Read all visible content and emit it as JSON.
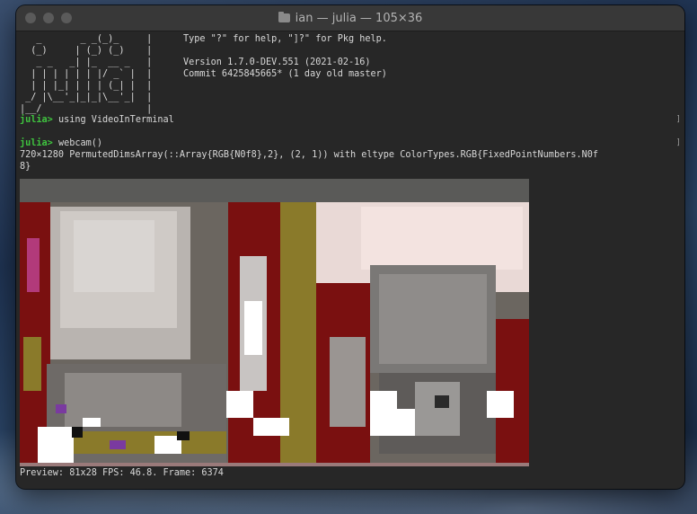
{
  "window": {
    "title": "ian — julia — 105×36",
    "folder_icon": "folder-icon"
  },
  "banner": {
    "logo_lines": [
      "   _       _ _(_)_     |",
      "  (_)     | (_) (_)    |",
      "   _ _   _| |_  __ _   |",
      "  | | | | | | |/ _` |  |",
      "  | | |_| | | | (_| |  |",
      " _/ |\\__'_|_|_|\\__'_|  |",
      "|__/                   |"
    ],
    "help_line": "Type \"?\" for help, \"]?\" for Pkg help.",
    "version_line": "Version 1.7.0-DEV.551 (2021-02-16)",
    "commit_line": "Commit 6425845665* (1 day old master)"
  },
  "session": {
    "prompt": "julia>",
    "command1": "using VideoInTerminal",
    "command2": "webcam()",
    "output_line1": "720×1280 PermutedDimsArray(::Array{RGB{N0f8},2}, (2, 1)) with eltype ColorTypes.RGB{FixedPointNumbers.N0f",
    "output_line2": "8}",
    "status_line": "Preview: 81x28 FPS: 46.8. Frame: 6374"
  },
  "colors": {
    "prompt_green": "#3fc43f",
    "terminal_bg": "#272727",
    "maroon": "#7a1010",
    "olive": "#8a7a2a"
  }
}
